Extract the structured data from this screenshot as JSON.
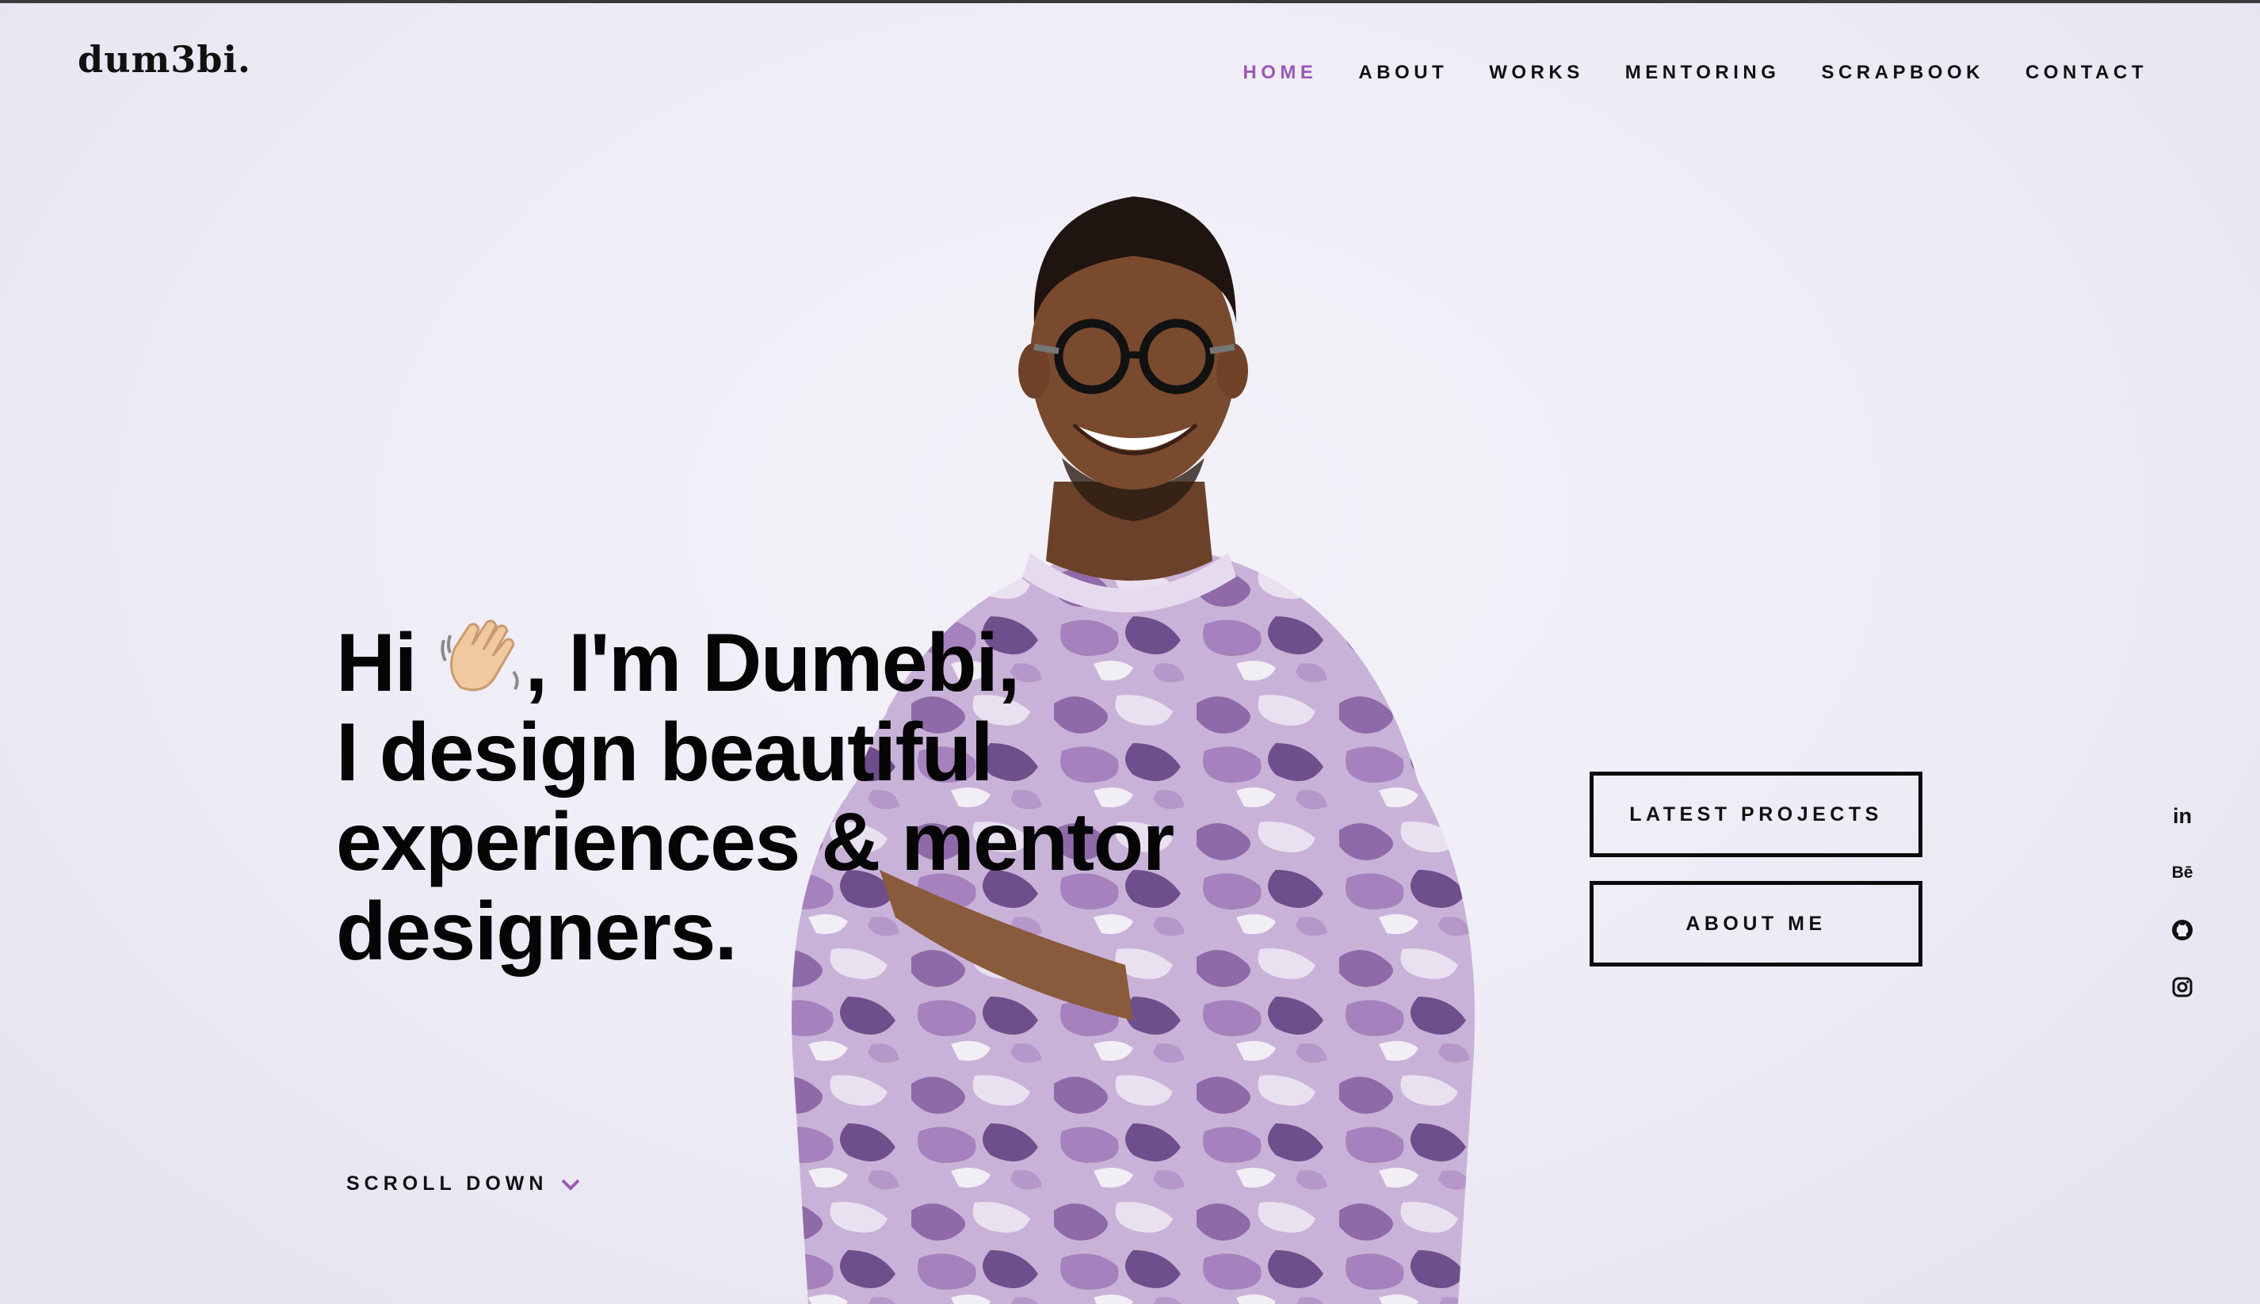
{
  "brand": {
    "logo": "dum3bi."
  },
  "nav": {
    "items": [
      {
        "label": "HOME",
        "active": true
      },
      {
        "label": "ABOUT",
        "active": false
      },
      {
        "label": "WORKS",
        "active": false
      },
      {
        "label": "MENTORING",
        "active": false
      },
      {
        "label": "SCRAPBOOK",
        "active": false
      },
      {
        "label": "CONTACT",
        "active": false
      }
    ],
    "active_color": "#9b59b6"
  },
  "hero": {
    "line1_pre": "Hi ",
    "line1_post": ", I'm Dumebi,",
    "wave_icon": "waving-hand-icon",
    "line2": "I design beautiful",
    "line3": "experiences & mentor",
    "line4": "designers."
  },
  "scroll": {
    "label": "SCROLL DOWN",
    "icon": "chevron-down-icon"
  },
  "buttons": {
    "latest_projects": "LATEST PROJECTS",
    "about_me": "ABOUT ME"
  },
  "social": {
    "linkedin": "in",
    "behance": "Bē",
    "icons": [
      "linkedin-icon",
      "behance-icon",
      "github-icon",
      "instagram-icon"
    ]
  },
  "colors": {
    "accent": "#9b59b6",
    "text": "#111111",
    "background": "#efedf6"
  }
}
